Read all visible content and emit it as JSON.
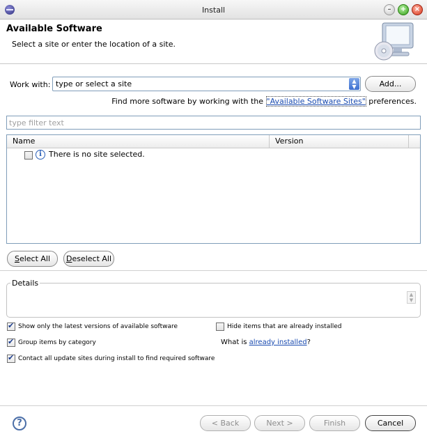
{
  "window": {
    "title": "Install"
  },
  "banner": {
    "title": "Available Software",
    "description": "Select a site or enter the location of a site."
  },
  "work_with": {
    "label": "Work with:",
    "value": "type or select a site",
    "add_button": "Add..."
  },
  "find_more": {
    "prefix": "Find more software by working with the ",
    "link": "\"Available Software Sites\"",
    "suffix": " preferences."
  },
  "filter": {
    "placeholder": "type filter text"
  },
  "table": {
    "columns": [
      "Name",
      "Version"
    ],
    "rows": [
      {
        "checked": false,
        "icon": "info-icon",
        "text": "There is no site selected."
      }
    ]
  },
  "selection_buttons": {
    "select_all": "Select All",
    "deselect_all": "Deselect All"
  },
  "details": {
    "label": "Details"
  },
  "options": {
    "latest_versions": {
      "checked": true,
      "label": "Show only the latest versions of available software"
    },
    "hide_installed": {
      "checked": false,
      "label": "Hide items that are already installed"
    },
    "group_by_category": {
      "checked": true,
      "label": "Group items by category"
    },
    "what_is_prefix": "What is ",
    "already_installed_link": "already installed",
    "what_is_suffix": "?",
    "contact_sites": {
      "checked": true,
      "label": "Contact all update sites during install to find required software"
    }
  },
  "footer": {
    "back": "< Back",
    "next": "Next >",
    "finish": "Finish",
    "cancel": "Cancel"
  },
  "colors": {
    "accent": "#3c6fd0",
    "link": "#1a4bb0",
    "border": "#7f9db9"
  }
}
